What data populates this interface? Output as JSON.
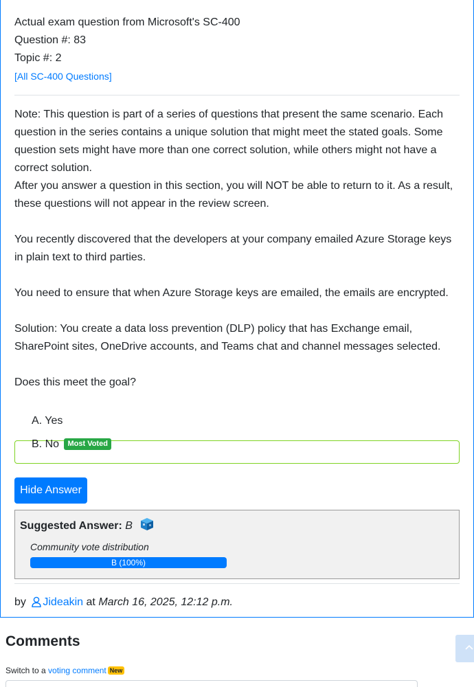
{
  "question": {
    "source": "Actual exam question from Microsoft's SC-400",
    "number": "Question #: 83",
    "topic": "Topic #: 2",
    "all_link": "[All SC-400 Questions]",
    "paragraphs": [
      "Note: This question is part of a series of questions that present the same scenario. Each question in the series contains a unique solution that might meet the stated goals. Some question sets might have more than one correct solution, while others might not have a correct solution.",
      "After you answer a question in this section, you will NOT be able to return to it. As a result, these questions will not appear in the review screen.",
      "You recently discovered that the developers at your company emailed Azure Storage keys in plain text to third parties.",
      "You need to ensure that when Azure Storage keys are emailed, the emails are encrypted.",
      "Solution: You create a data loss prevention (DLP) policy that has Exchange email, SharePoint sites, OneDrive accounts, and Teams chat and channel messages selected.",
      "Does this meet the goal?"
    ],
    "choices": [
      {
        "label": "A. Yes"
      },
      {
        "label": "B. No",
        "badge": "Most Voted"
      }
    ]
  },
  "hide_answer_button": "Hide Answer",
  "answer": {
    "label": "Suggested Answer:",
    "value": "B",
    "distribution_label": "Community vote distribution",
    "distribution": [
      {
        "label": "B (100%)",
        "percent": 100
      }
    ]
  },
  "byline": {
    "prefix": "by",
    "user": "Jideakin",
    "at": "at",
    "date": "March 16, 2025, 12:12 p.m."
  },
  "comments": {
    "title": "Comments",
    "switch_prefix": "Switch to a",
    "switch_link": "voting comment",
    "new_badge": "New"
  },
  "colors": {
    "primary": "#007bff",
    "most_voted": "#28a745",
    "new_badge": "#ffc107",
    "selected_choice_border": "#7ed321"
  }
}
